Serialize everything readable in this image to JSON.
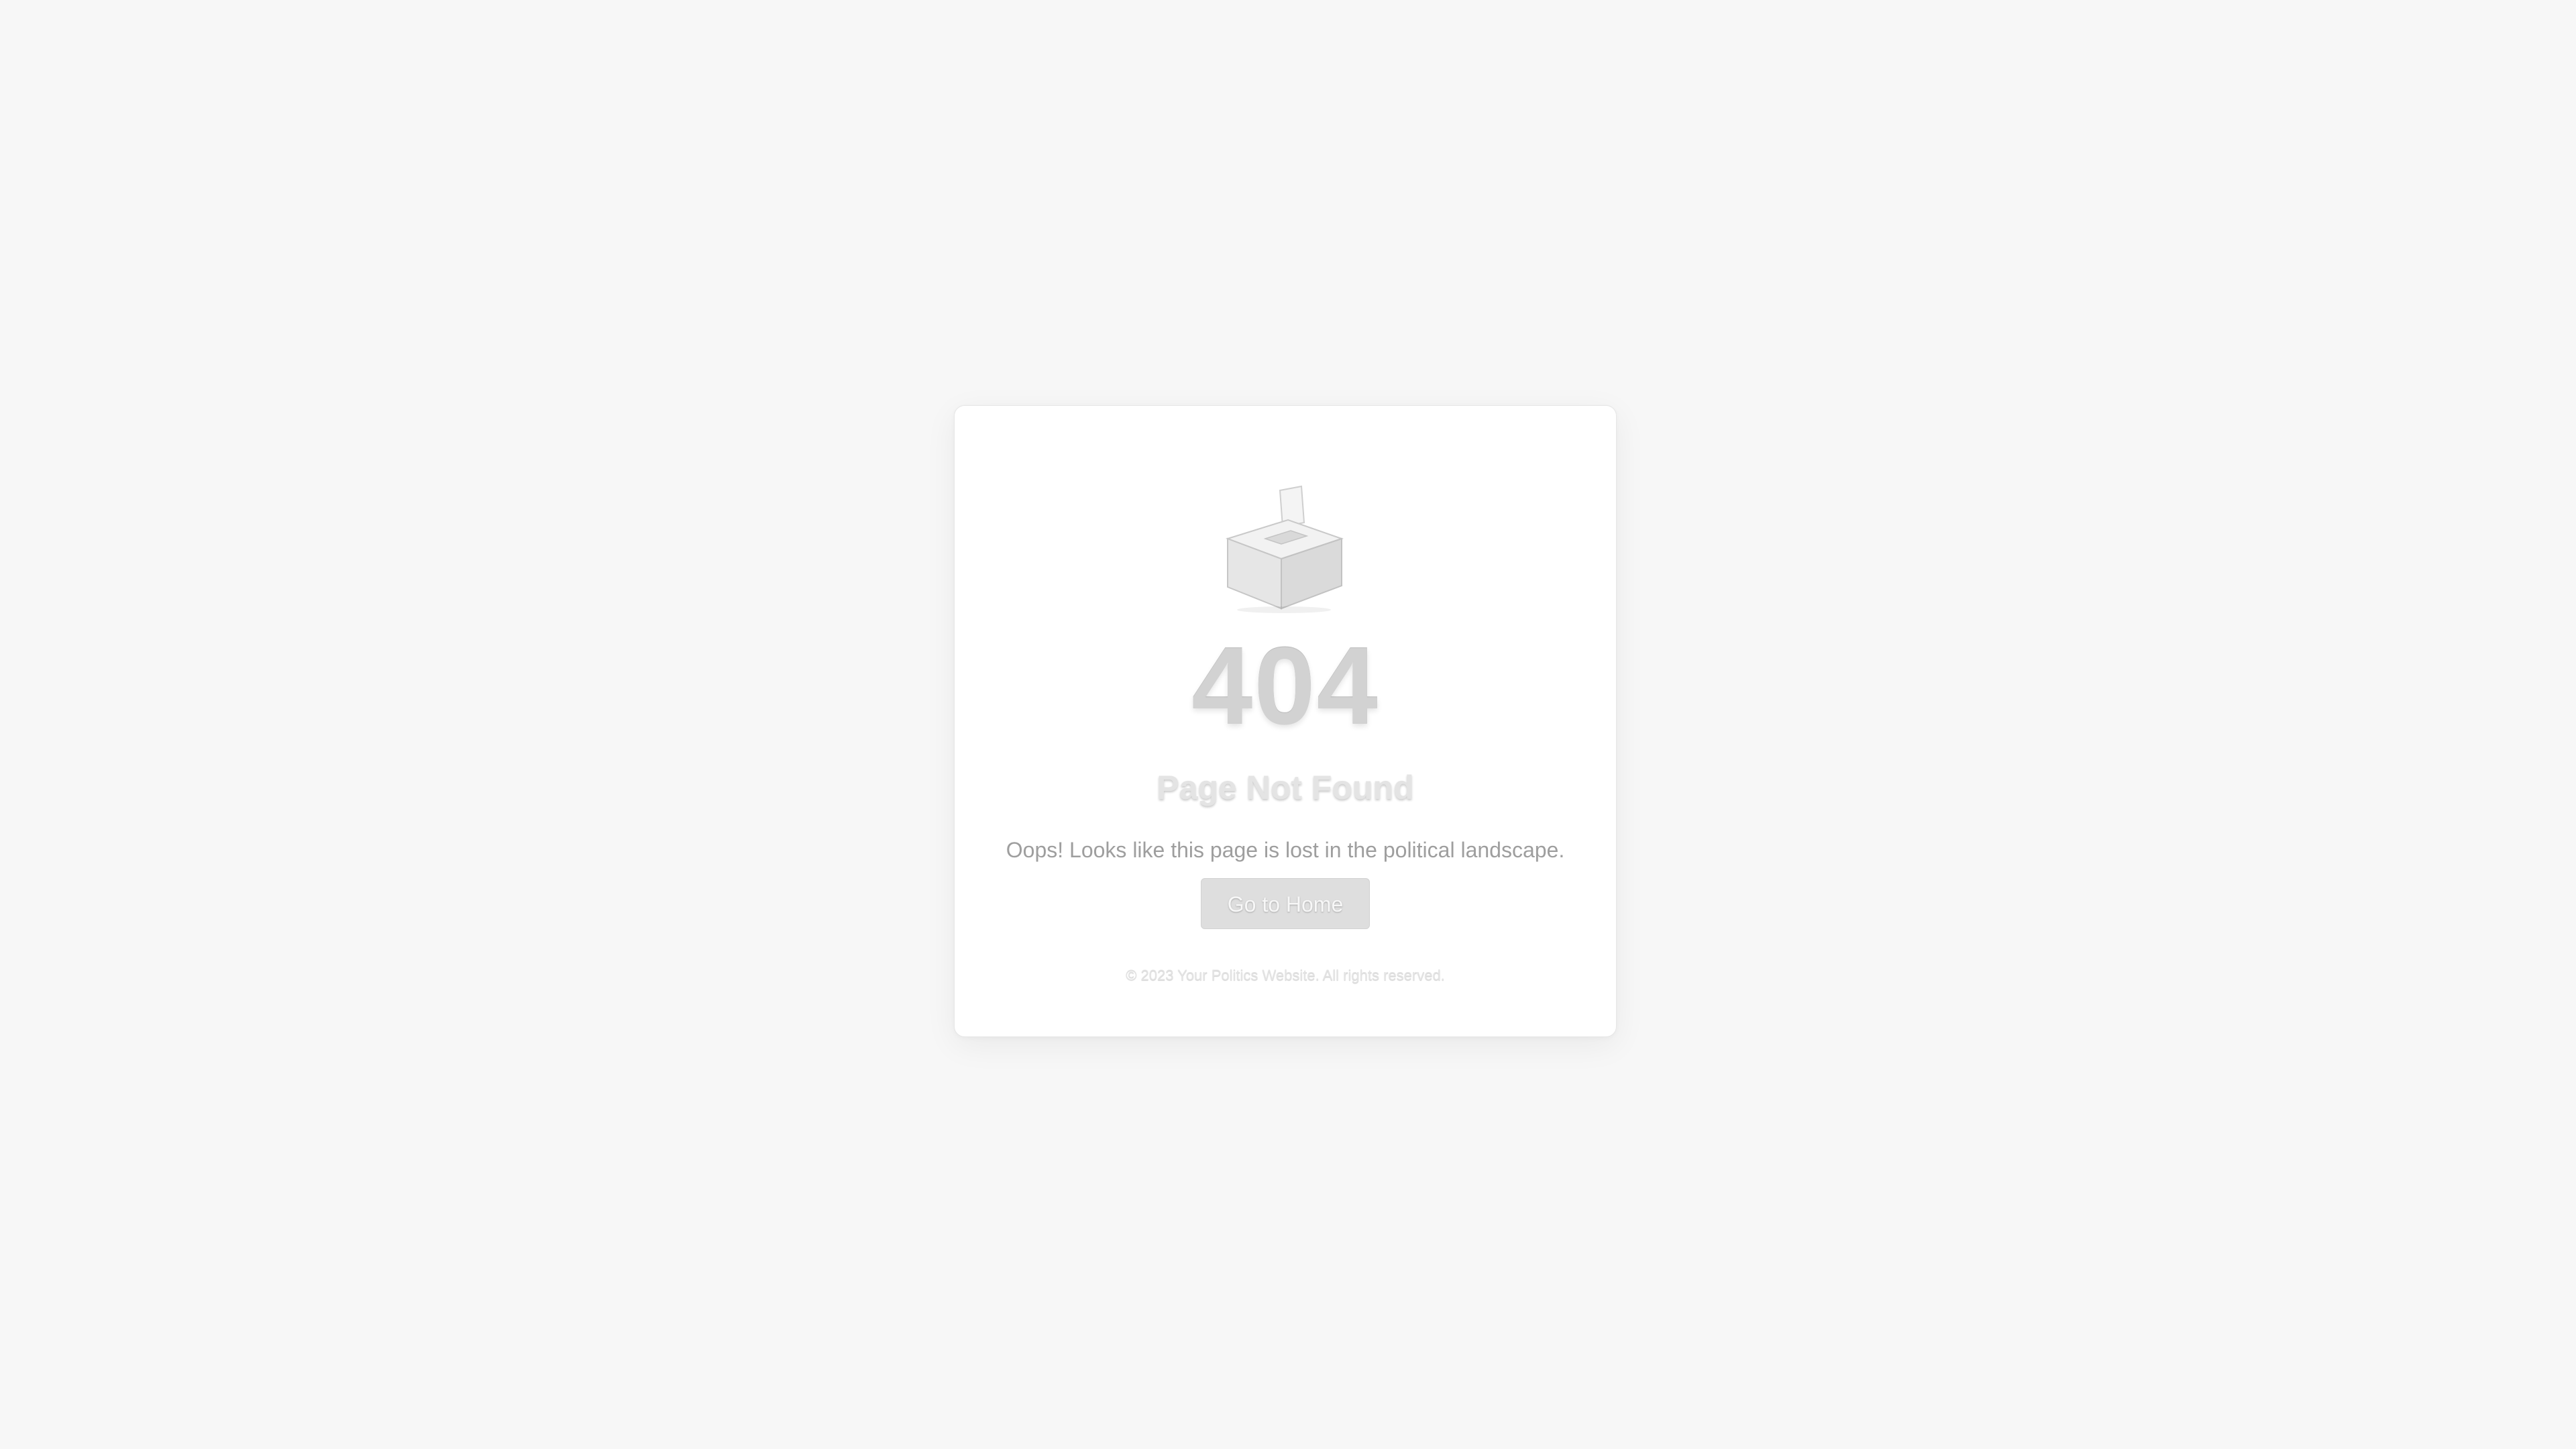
{
  "error": {
    "icon": "ballot-box-icon",
    "code": "404",
    "title": "Page Not Found",
    "message": "Oops! Looks like this page is lost in the political landscape."
  },
  "actions": {
    "home_label": "Go to Home"
  },
  "footer": {
    "text": "© 2023 Your Politics Website. All rights reserved."
  },
  "colors": {
    "background": "#f7f7f7",
    "card": "#ffffff",
    "button": "#dedede",
    "code": "#d2d2d2"
  }
}
